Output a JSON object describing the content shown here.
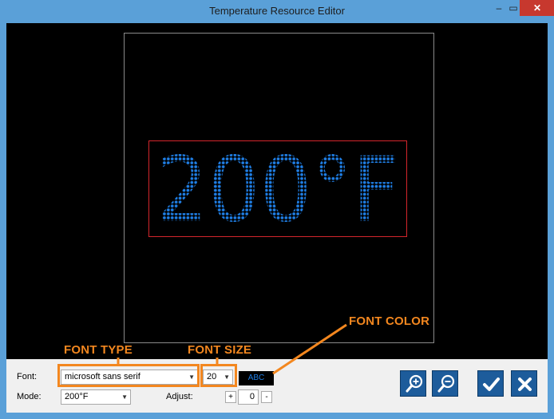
{
  "window": {
    "title": "Temperature Resource Editor",
    "min_glyph": "–",
    "max_glyph": "▭",
    "close_glyph": "✕"
  },
  "preview": {
    "text": "200°F",
    "led_color": "#1f7fe6"
  },
  "controls": {
    "font_label": "Font:",
    "font_value": "microsoft sans serif",
    "font_size_value": "20",
    "color_swatch_text": "ABC",
    "mode_label": "Mode:",
    "mode_value": "200°F",
    "adjust_label": "Adjust:",
    "adjust_plus": "+",
    "adjust_value": "0",
    "adjust_minus": "-"
  },
  "buttons": {
    "zoom_in": "zoom-in-icon",
    "zoom_out": "zoom-out-icon",
    "ok": "check-icon",
    "cancel": "close-icon"
  },
  "annotations": {
    "font_type": "FONT TYPE",
    "font_size": "FONT SIZE",
    "font_color": "FONT COLOR",
    "accent": "#f3871f"
  }
}
